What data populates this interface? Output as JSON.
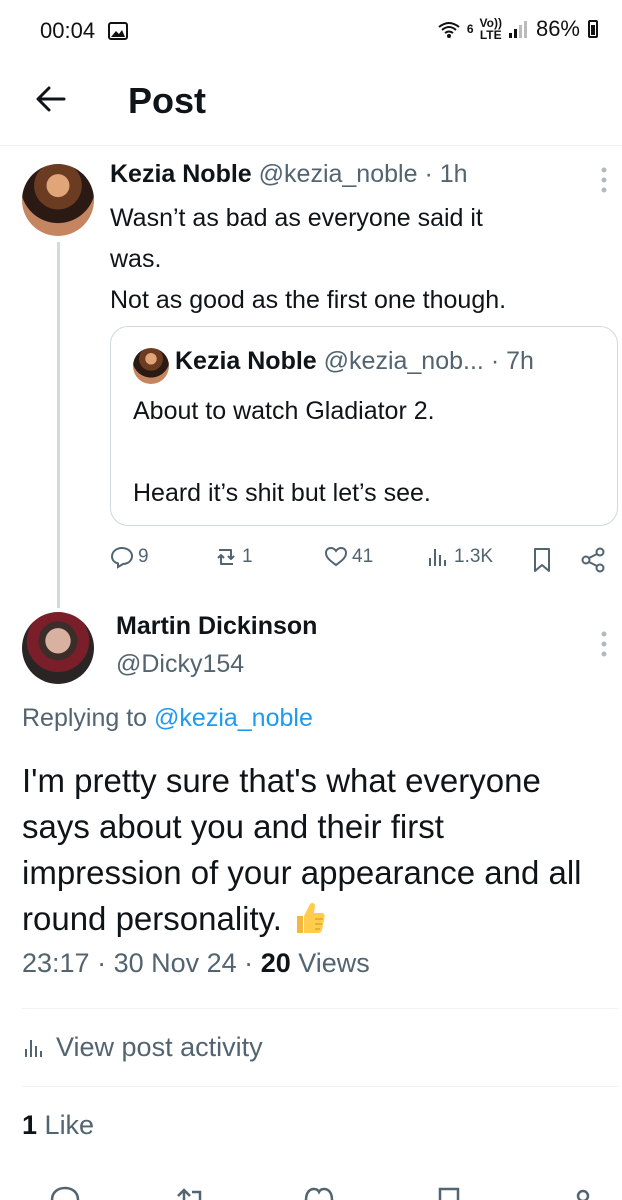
{
  "status_bar": {
    "time": "00:04",
    "signal_top": "6",
    "volte_top": "Vo))",
    "volte_bottom": "LTE",
    "battery": "86%"
  },
  "header": {
    "title": "Post"
  },
  "tweet": {
    "name": "Kezia Noble",
    "handle": "@kezia_noble",
    "time": "· 1h",
    "body_lines": [
      "Wasn’t as bad as everyone said it",
      "was.",
      "Not as good as the first one though."
    ],
    "quote": {
      "name": "Kezia Noble",
      "handle": "@kezia_nob...",
      "time": "· 7h",
      "body_line1": "About to watch Gladiator 2.",
      "body_line2": "Heard it’s shit but let’s see."
    },
    "actions": {
      "replies": "9",
      "reposts": "1",
      "likes": "41",
      "views": "1.3K"
    }
  },
  "reply": {
    "name": "Martin Dickinson",
    "handle": "@Dicky154",
    "replying_prefix": "Replying to",
    "replying_handle": "@kezia_noble",
    "body": "I'm pretty sure that's what everyone says about you and their first impression of your appearance and all round personality.",
    "time": "23:17",
    "date": "· 30 Nov 24 ·",
    "views_count": "20",
    "views_label": "Views",
    "activity_label": "View post activity",
    "likes_count": "1",
    "likes_label": "Like"
  },
  "icons": [
    "back-arrow-icon",
    "more-icon",
    "reply-icon",
    "repost-icon",
    "like-icon",
    "views-icon",
    "bookmark-icon",
    "share-icon",
    "thumbs-up-emoji"
  ]
}
